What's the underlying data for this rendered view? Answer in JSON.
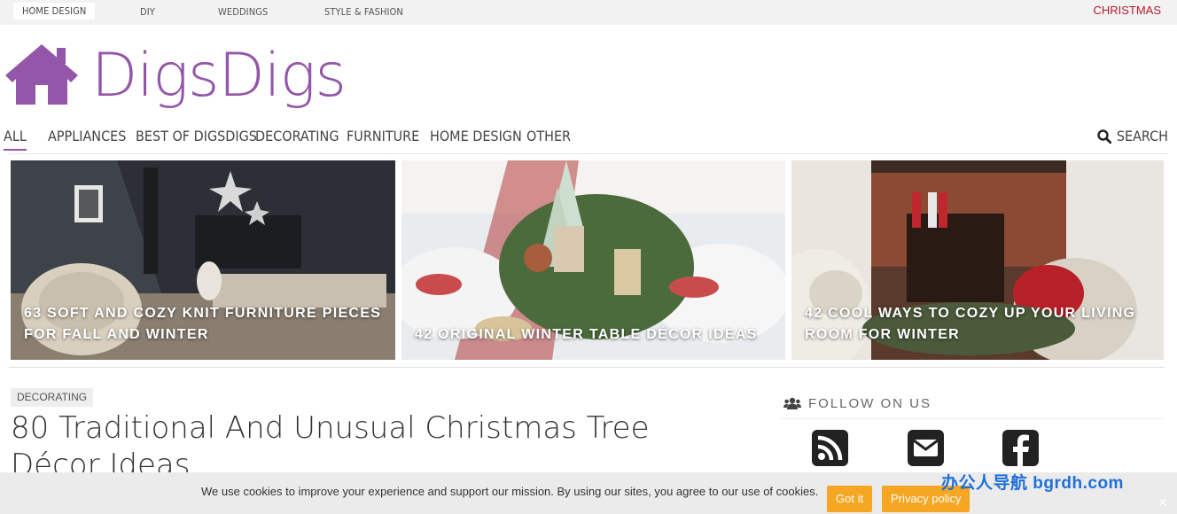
{
  "topbar": {
    "links": [
      "HOME DESIGN",
      "DIY",
      "WEDDINGS",
      "STYLE & FASHION"
    ],
    "christmas": "CHRISTMAS"
  },
  "logo": {
    "text": "DigsDigs",
    "color": "#9356a8"
  },
  "nav": {
    "items": [
      "ALL",
      "APPLIANCES",
      "BEST OF DIGSDIGS",
      "DECORATING",
      "FURNITURE",
      "HOME DESIGN",
      "OTHER"
    ],
    "search": "SEARCH"
  },
  "featured": [
    {
      "caption": "63 SOFT AND COZY KNIT FURNITURE PIECES FOR FALL AND WINTER"
    },
    {
      "caption": "42 ORIGINAL WINTER TABLE DÉCOR IDEAS"
    },
    {
      "caption": "42 COOL WAYS TO COZY UP YOUR LIVING ROOM FOR WINTER"
    }
  ],
  "article": {
    "category": "DECORATING",
    "title": "80 Traditional And Unusual Christmas Tree Décor Ideas"
  },
  "sidebar": {
    "follow_heading": "FOLLOW ON US"
  },
  "cookie": {
    "message": "We use cookies to improve your experience and support our mission. By using our sites, you agree to our use of cookies.",
    "got_it": "Got it",
    "privacy": "Privacy policy",
    "close": "✕"
  },
  "watermark": "办公人导航  bgrdh.com",
  "colors": {
    "brand": "#9356a8",
    "accent": "#b01c2e",
    "button": "#f5a623"
  }
}
